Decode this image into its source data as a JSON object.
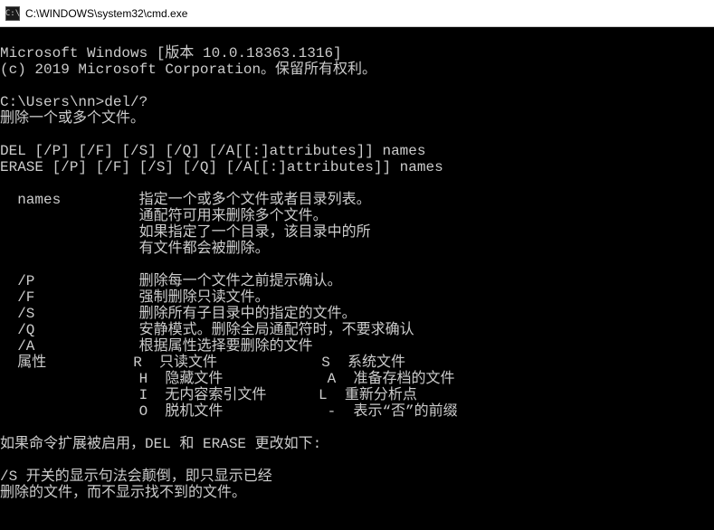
{
  "titlebar": {
    "icon_text": "C:\\",
    "title": "C:\\WINDOWS\\system32\\cmd.exe"
  },
  "lines": {
    "l0": "Microsoft Windows [版本 10.0.18363.1316]",
    "l1": "(c) 2019 Microsoft Corporation。保留所有权利。",
    "l2": "",
    "l3": "C:\\Users\\nn>del/?",
    "l4": "删除一个或多个文件。",
    "l5": "",
    "l6": "DEL [/P] [/F] [/S] [/Q] [/A[[:]attributes]] names",
    "l7": "ERASE [/P] [/F] [/S] [/Q] [/A[[:]attributes]] names",
    "l8": "",
    "l9": "  names         指定一个或多个文件或者目录列表。",
    "l10": "                通配符可用来删除多个文件。",
    "l11": "                如果指定了一个目录，该目录中的所",
    "l12": "                有文件都会被删除。",
    "l13": "",
    "l14": "  /P            删除每一个文件之前提示确认。",
    "l15": "  /F            强制删除只读文件。",
    "l16": "  /S            删除所有子目录中的指定的文件。",
    "l17": "  /Q            安静模式。删除全局通配符时，不要求确认",
    "l18": "  /A            根据属性选择要删除的文件",
    "l19": "  属性          R  只读文件            S  系统文件",
    "l20": "                H  隐藏文件            A  准备存档的文件",
    "l21": "                I  无内容索引文件      L  重新分析点",
    "l22": "                O  脱机文件            -  表示“否”的前缀",
    "l23": "",
    "l24": "如果命令扩展被启用，DEL 和 ERASE 更改如下:",
    "l25": "",
    "l26": "/S 开关的显示句法会颠倒，即只显示已经",
    "l27": "删除的文件，而不显示找不到的文件。",
    "l28": ""
  }
}
